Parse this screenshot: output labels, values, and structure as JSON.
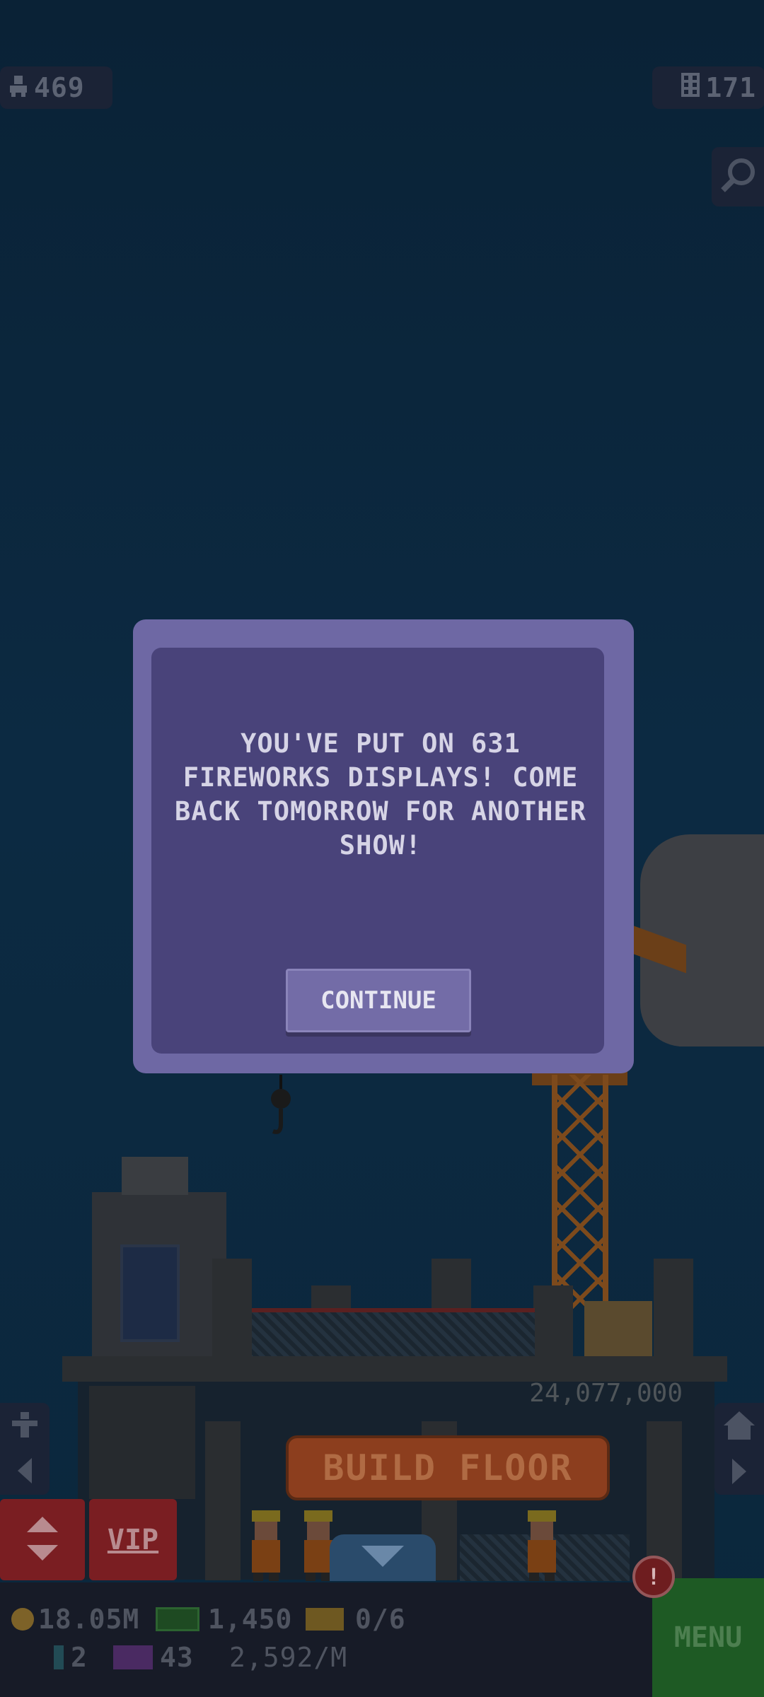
{
  "hud": {
    "population": "469",
    "floors": "171"
  },
  "dialog": {
    "message": "YOU'VE PUT ON 631 FIREWORKS DISPLAYS! COME BACK TOMORROW FOR ANOTHER SHOW!",
    "continue_label": "CONTINUE"
  },
  "build": {
    "cost": "24,077,000",
    "label": "BUILD FLOOR"
  },
  "buttons": {
    "vip_label": "VIP",
    "menu_label": "MENU",
    "alert_label": "!"
  },
  "stats": {
    "coins": "18.05M",
    "bux": "1,450",
    "tickets": "0/6",
    "gems": "2",
    "tix": "43",
    "rate": "2,592/M"
  },
  "icons": {
    "population": "person-icon",
    "floors": "building-icon",
    "zoom": "magnifier-icon",
    "elevator": "elevator-arrows-icon",
    "left_nav": "person-left-icon",
    "right_nav": "home-right-icon",
    "down": "chevron-down-icon"
  },
  "colors": {
    "dialog_outer": "#6e68a4",
    "dialog_inner": "#49437a",
    "build_button": "#8c3e1e",
    "vip_button": "#7a1e22",
    "menu_button": "#1e5a24"
  }
}
